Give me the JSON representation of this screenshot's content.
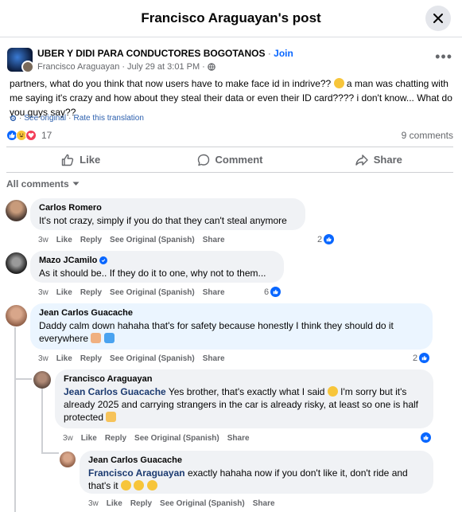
{
  "header": {
    "title": "Francisco Araguayan's post"
  },
  "post": {
    "group_name": "UBER Y DIDI PARA CONDUCTORES BOGOTANOS",
    "separator": "·",
    "join_label": "Join",
    "author": "Francisco Araguayan",
    "date": "July 29 at 3:01 PM",
    "privacy_icon": "globe-icon",
    "text_part1": "partners, what do you think that now users have to make face id in indrive??",
    "text_part2": "a man was chatting with me saying it's crazy and how about they steal their data or even their ID card???? i don't know... What do you guys say??",
    "see_original": "See original",
    "rate_translation": "Rate this translation",
    "reaction_count": "17",
    "comments_count": "9 comments"
  },
  "actions": {
    "like": "Like",
    "comment": "Comment",
    "share": "Share"
  },
  "comments_filter": "All comments",
  "labels": {
    "like": "Like",
    "reply": "Reply",
    "see_original": "See Original (Spanish)",
    "share": "Share"
  },
  "comments": [
    {
      "author": "Carlos Romero",
      "text": "It's not crazy, simply if you do that they can't steal anymore",
      "time": "3w",
      "likes": "2"
    },
    {
      "author": "Mazo JCamilo",
      "verified": true,
      "text": "As it should be.. If they do it to one, why not to them...",
      "time": "3w",
      "likes": "6"
    },
    {
      "author": "Jean Carlos Guacache",
      "text": "Daddy calm down hahaha that's for safety because honestly I think they should do it everywhere",
      "time": "3w",
      "likes": "2"
    },
    {
      "author": "Francisco Araguayan",
      "mention": "Jean Carlos Guacache",
      "text": "Yes brother, that's exactly what I said",
      "text2": "I'm sorry but it's already 2025 and carrying strangers in the car is already risky, at least so one is half protected",
      "time": "3w"
    },
    {
      "author": "Jean Carlos Guacache",
      "mention": "Francisco Araguayan",
      "text": "exactly hahaha now if you don't like it, don't ride and that's it",
      "time": "3w"
    }
  ],
  "colors": {
    "accent": "#0866ff",
    "bubble": "#f0f2f5",
    "muted": "#65676b"
  }
}
